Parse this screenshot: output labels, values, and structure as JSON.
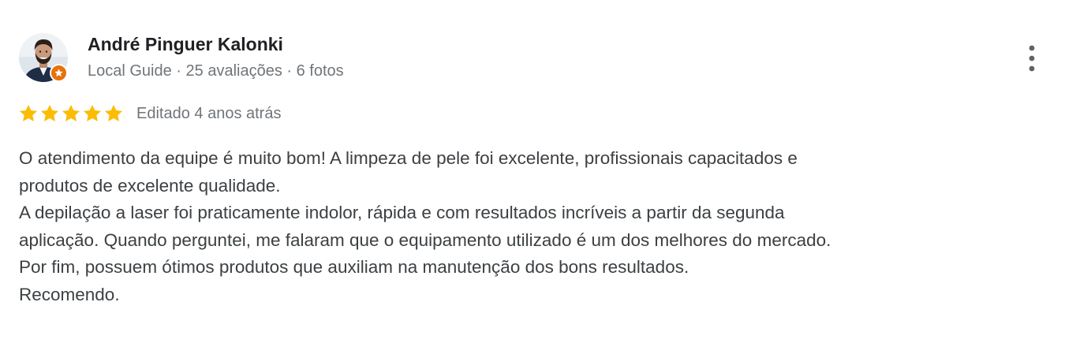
{
  "author": {
    "name": "André Pinguer Kalonki",
    "badge": "Local Guide",
    "reviews_count": "25 avaliações",
    "photos_count": "6 fotos",
    "separator": " · ",
    "avatar_icon": "person-photo-icon",
    "badge_icon": "local-guide-star-icon",
    "badge_color": "#e8710a"
  },
  "review": {
    "rating": 5,
    "max_rating": 5,
    "star_color": "#fbbc04",
    "time": "Editado 4 anos atrás",
    "text_lines": [
      "O atendimento da equipe é muito bom! A limpeza de pele foi excelente, profissionais capacitados e",
      "produtos de excelente qualidade.",
      "A depilação a laser foi praticamente indolor, rápida e com resultados incríveis a partir da segunda",
      "aplicação. Quando perguntei, me falaram que o equipamento utilizado é um dos melhores do mercado.",
      "Por fim, possuem ótimos produtos que auxiliam na manutenção dos bons resultados.",
      "Recomendo."
    ]
  },
  "actions": {
    "more_icon": "more-vertical-icon"
  }
}
